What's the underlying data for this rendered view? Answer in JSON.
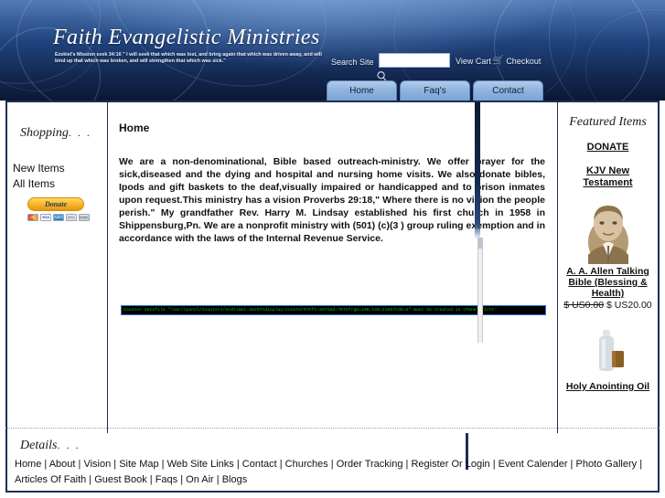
{
  "header": {
    "site_title": "Faith Evangelistic Ministries",
    "tagline": "Ezekiel's Mission ezek 34:16 \" I will seek that which was lost, and bring again that which was driven away, and will bind up that which was broken, and will strengthen that which was sick.\"",
    "search_label": "Search Site",
    "search_value": "",
    "search_placeholder": "",
    "search_icon": "magnifier-icon",
    "view_cart_label": "View Cart",
    "cart_icon": "shopping-cart-icon",
    "checkout_label": "Checkout",
    "colors": {
      "banner_top": "#3f6cab",
      "banner_bottom": "#0b1833",
      "tab_fill": "#8fb3de",
      "frame_border": "#1b2e55"
    }
  },
  "nav": {
    "tabs": [
      {
        "label": "Home"
      },
      {
        "label": "Faq's"
      },
      {
        "label": "Contact"
      }
    ]
  },
  "sidebar_left": {
    "heading": "Shopping",
    "heading_dots": ". . .",
    "links": [
      {
        "label": "New Items"
      },
      {
        "label": "All Items"
      }
    ],
    "donate_button_label": "Donate",
    "card_logos": [
      {
        "name": "mastercard-logo",
        "text": "MC"
      },
      {
        "name": "visa-logo",
        "text": "VISA"
      },
      {
        "name": "amex-logo",
        "text": "AMEX"
      },
      {
        "name": "discover-logo",
        "text": "DISC"
      },
      {
        "name": "echeck-logo",
        "text": "BANK"
      }
    ]
  },
  "main": {
    "page_title": "Home",
    "intro_paragraph": "We are a non-denominational, Bible based outreach-ministry. We offer prayer for the sick,diseased and the dying and hospital and nursing home visits. We also donate bibles, Ipods and gift baskets to the deaf,visually impaired or handicapped and to prison inmates upon request.This ministry has a vision Proverbs 29:18,\" Where there is no vision the people perish.\" My grandfather Rev. Harry M. Lindsay established his first church in 1958 in Shippensburg,Pn. We are a nonprofit ministry with (501) (c)(3 )  group ruling exemption and in accordance with the laws of the Internal Revenue Service.",
    "counter_error": "Counter datafile \"/var/cpanel/Counters/endtime1.dat%7Cdisplay=Counter%7Cft=2%7Cmd=7%7Cfrgb=100;139;216%7Cdd=U\" must be created in cPanel first!",
    "counter_error_colors": {
      "text": "#12c21a",
      "background": "#000000",
      "border": "#2f6fd0"
    }
  },
  "sidebar_right": {
    "heading": "Featured Items",
    "heading_dots": "",
    "links": [
      {
        "label": "DONATE"
      },
      {
        "label": "KJV New Testament"
      }
    ],
    "products": [
      {
        "image_name": "portrait-photo-a-a-allen",
        "name": "A. A. Allen Talking Bible (Blessing & Health)",
        "price_old": "$ US0.00",
        "price_new": "$ US20.00"
      },
      {
        "image_name": "anointing-oil-bottle-photo",
        "name": "Holy Anointing Oil",
        "price_old": "",
        "price_new": ""
      }
    ]
  },
  "footer": {
    "heading": "Details",
    "heading_dots": ". . .",
    "links": [
      "Home",
      "About",
      "Vision",
      "Site Map",
      "Web Site Links",
      "Contact",
      "Churches",
      "Order Tracking",
      "Register Or Login",
      "Event Calender",
      "Photo Gallery",
      "Articles Of Faith",
      "Guest Book",
      "Faqs",
      "On Air",
      "Blogs"
    ],
    "separator": "|"
  }
}
